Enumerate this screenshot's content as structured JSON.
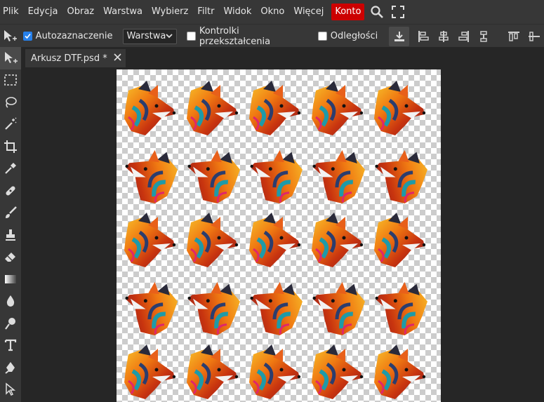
{
  "menu": [
    "Plik",
    "Edycja",
    "Obraz",
    "Warstwa",
    "Wybierz",
    "Filtr",
    "Widok",
    "Okno",
    "Więcej",
    "Konto"
  ],
  "options": {
    "autoselect_label": "Autozaznaczenie",
    "layer_select_value": "Warstwa",
    "transform_controls_label": "Kontrolki przekształcenia",
    "distances_label": "Odległości"
  },
  "tab": {
    "title": "Arkusz DTF.psd *"
  },
  "canvas": {
    "rows": 5,
    "cols": 5,
    "motif": "fox-head"
  },
  "colors": {
    "accent": "#cc0000",
    "checkbox": "#2680eb"
  }
}
